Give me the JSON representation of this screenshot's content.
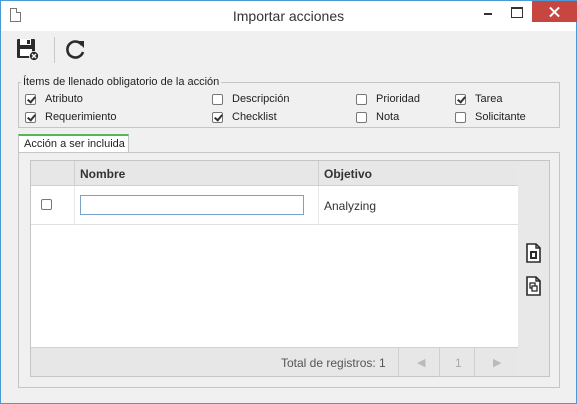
{
  "window": {
    "title": "Importar acciones"
  },
  "toolbar": {
    "save_icon": "save-close-icon",
    "refresh_icon": "refresh-icon"
  },
  "required_items": {
    "legend": "Ítems de llenado obligatorio de la acción",
    "options": [
      {
        "label": "Atributo",
        "checked": true
      },
      {
        "label": "Descripción",
        "checked": false
      },
      {
        "label": "Prioridad",
        "checked": false
      },
      {
        "label": "Tarea",
        "checked": true
      },
      {
        "label": "Requerimiento",
        "checked": true
      },
      {
        "label": "Checklist",
        "checked": true
      },
      {
        "label": "Nota",
        "checked": false
      },
      {
        "label": "Solicitante",
        "checked": false
      }
    ]
  },
  "tab": {
    "label": "Acción a ser incluida"
  },
  "grid": {
    "columns": [
      "Nombre",
      "Objetivo"
    ],
    "rows": [
      {
        "checked": false,
        "nombre": "",
        "objetivo": "Analyzing"
      }
    ],
    "total_label": "Total de registros: 1",
    "page": "1",
    "prev_symbol": "◀",
    "next_symbol": "▶"
  },
  "side_buttons": [
    "import-file-icon",
    "copy-document-icon"
  ]
}
